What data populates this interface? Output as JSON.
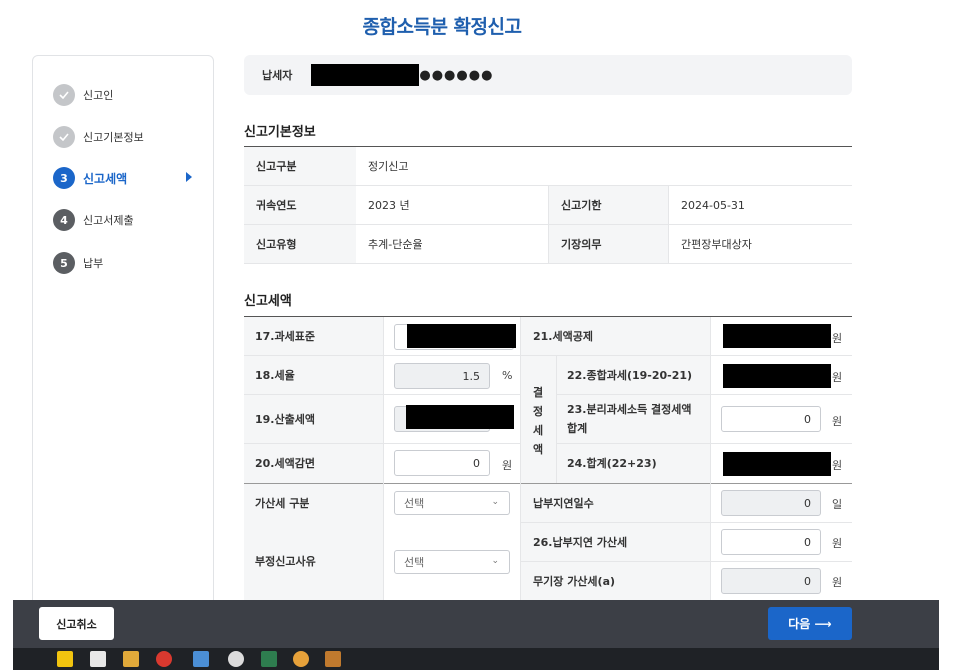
{
  "page_title": "종합소득분 확정신고",
  "steps": [
    {
      "num": "",
      "label": "신고인",
      "state": "done"
    },
    {
      "num": "",
      "label": "신고기본정보",
      "state": "done"
    },
    {
      "num": "3",
      "label": "신고세액",
      "state": "active"
    },
    {
      "num": "4",
      "label": "신고서제출",
      "state": "todo"
    },
    {
      "num": "5",
      "label": "납부",
      "state": "todo"
    }
  ],
  "taxpayer": {
    "label": "납세자",
    "masked_suffix": "●●●●●●"
  },
  "basic_info": {
    "title": "신고기본정보",
    "report_type_label": "신고구분",
    "report_type": "정기신고",
    "year_label": "귀속연도",
    "year": "2023 년",
    "deadline_label": "신고기한",
    "deadline": "2024-05-31",
    "filing_type_label": "신고유형",
    "filing_type": "추계-단순율",
    "bookkeeping_label": "기장의무",
    "bookkeeping": "간편장부대상자"
  },
  "tax_amount": {
    "title": "신고세액",
    "tax_base_label": "17.과세표준",
    "tax_rate_label": "18.세율",
    "tax_rate_value": "1.5",
    "tax_rate_unit": "%",
    "computed_tax_label": "19.산출세액",
    "tax_reduction_label": "20.세액감면",
    "tax_reduction_value": "0",
    "tax_reduction_unit": "원",
    "tax_credit_label": "21.세액공제",
    "tax_credit_unit": "원",
    "decided_tax_label": "결정세액",
    "general_tax_label": "22.종합과세(19-20-21)",
    "general_tax_unit": "원",
    "separate_tax_label": "23.분리과세소득 결정세액 합계",
    "separate_tax_value": "0",
    "separate_tax_unit": "원",
    "total_label": "24.합계(22+23)",
    "total_unit": "원",
    "penalty_type_label": "가산세 구분",
    "penalty_type_select": "선택",
    "late_days_label": "납부지연일수",
    "late_days_value": "0",
    "late_days_unit": "일",
    "late_penalty_label": "26.납부지연 가산세",
    "late_penalty_value": "0",
    "late_penalty_unit": "원",
    "unfaithful_reason_label": "부정신고사유",
    "unfaithful_reason_select": "선택",
    "no_book_penalty_label": "무기장 가산세(a)",
    "no_book_penalty_value": "0",
    "no_book_penalty_unit": "원"
  },
  "buttons": {
    "cancel": "신고취소",
    "next": "다음 ⟶"
  }
}
